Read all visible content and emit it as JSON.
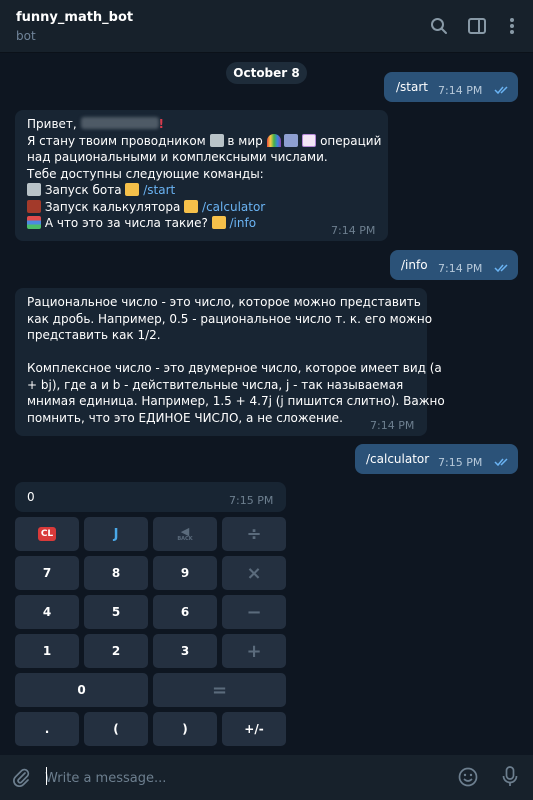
{
  "header": {
    "title": "funny_math_bot",
    "subtitle": "bot"
  },
  "date": "October 8",
  "messages": {
    "start": {
      "text": "/start",
      "time": "7:14 PM"
    },
    "welcome": {
      "greeting": "Привет,",
      "line2a": "Я стану твоим проводником",
      "line2b": "в мир",
      "line2c": "операций",
      "line3": "над рациональными и комплексными числами.",
      "line4": "Тебе доступны следующие команды:",
      "cmd1_label": "Запуск бота",
      "cmd1_link": "/start",
      "cmd2_label": "Запуск калькулятора",
      "cmd2_link": "/calculator",
      "cmd3_label": "А что это за числа такие?",
      "cmd3_link": "/info",
      "time": "7:14 PM"
    },
    "info_cmd": {
      "text": "/info",
      "time": "7:14 PM"
    },
    "info_reply": {
      "p1_l1": "Рациональное число - это число, которое можно представить",
      "p1_l2": "как дробь. Например, 0.5 - рациональное число т. к. его можно",
      "p1_l3": "представить как 1/2.",
      "p2_l1": "Комплексное число - это двумерное число, которое имеет вид (a",
      "p2_l2": "+ bj), где a и b - действительные числа, j - так называемая",
      "p2_l3": "мнимая единица. Например, 1.5 + 4.7j (j пишится слитно). Важно",
      "p2_l4": "помнить, что это ЕДИНОЕ  ЧИСЛО, а не сложение.",
      "time": "7:14 PM"
    },
    "calc_cmd": {
      "text": "/calculator",
      "time": "7:15 PM"
    },
    "calc_display": {
      "text": "0",
      "time": "7:15 PM"
    }
  },
  "keyboard": {
    "r1": [
      "CL",
      "J",
      "BACK",
      "÷"
    ],
    "r2": [
      "7",
      "8",
      "9",
      "×"
    ],
    "r3": [
      "4",
      "5",
      "6",
      "−"
    ],
    "r4": [
      "1",
      "2",
      "3",
      "+"
    ],
    "r5": [
      "0",
      "="
    ],
    "r6": [
      ".",
      "(",
      ")",
      "+/-"
    ]
  },
  "input": {
    "placeholder": "Write a message..."
  },
  "colors": {
    "background": "#0e1621",
    "header": "#17212b",
    "outgoing_bubble": "#2b5278",
    "incoming_bubble": "#182533",
    "link": "#6ab3f3",
    "key": "#243040"
  },
  "icons": [
    "search-icon",
    "sidebar-toggle-icon",
    "more-vertical-icon",
    "double-check-icon",
    "attach-icon",
    "emoji-icon",
    "microphone-icon"
  ]
}
